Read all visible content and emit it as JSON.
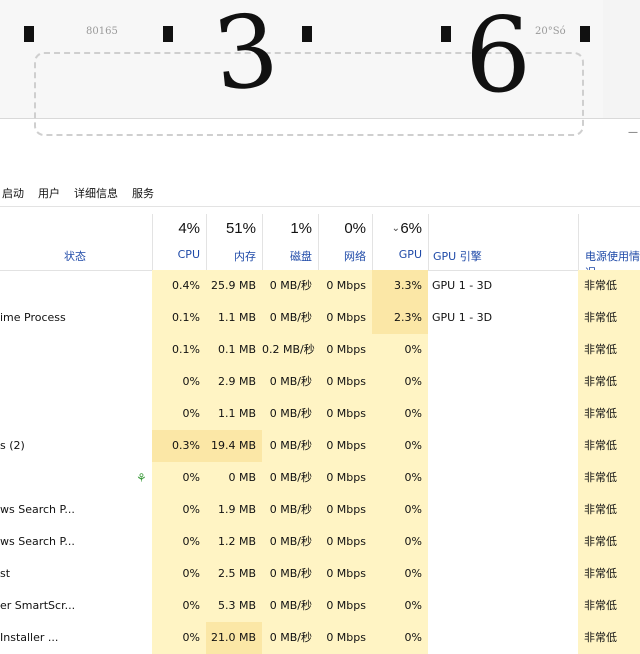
{
  "paper": {
    "printed_number": "80165",
    "printed_number2": "20°Só",
    "hand_left": "3",
    "hand_right": "6"
  },
  "tabs": [
    "启动",
    "用户",
    "详细信息",
    "服务"
  ],
  "header": {
    "status_label": "状态",
    "cpu": {
      "pct": "4%",
      "label": "CPU"
    },
    "mem": {
      "pct": "51%",
      "label": "内存"
    },
    "disk": {
      "pct": "1%",
      "label": "磁盘"
    },
    "net": {
      "pct": "0%",
      "label": "网络"
    },
    "gpu": {
      "pct": "6%",
      "label": "GPU",
      "sort_icon": "chevron-down-icon"
    },
    "gpu_engine": {
      "label": "GPU 引擎"
    },
    "power": {
      "label": "电源使用情况"
    }
  },
  "processes": [
    {
      "name": "",
      "cpu": "0.4%",
      "mem": "25.9 MB",
      "disk": "0 MB/秒",
      "net": "0 Mbps",
      "gpu": "3.3%",
      "engine": "GPU 1 - 3D",
      "power": "非常低"
    },
    {
      "name": "ime Process",
      "cpu": "0.1%",
      "mem": "1.1 MB",
      "disk": "0 MB/秒",
      "net": "0 Mbps",
      "gpu": "2.3%",
      "engine": "GPU 1 - 3D",
      "power": "非常低"
    },
    {
      "name": "",
      "cpu": "0.1%",
      "mem": "0.1 MB",
      "disk": "0.2 MB/秒",
      "net": "0 Mbps",
      "gpu": "0%",
      "engine": "",
      "power": "非常低"
    },
    {
      "name": "",
      "cpu": "0%",
      "mem": "2.9 MB",
      "disk": "0 MB/秒",
      "net": "0 Mbps",
      "gpu": "0%",
      "engine": "",
      "power": "非常低"
    },
    {
      "name": "",
      "cpu": "0%",
      "mem": "1.1 MB",
      "disk": "0 MB/秒",
      "net": "0 Mbps",
      "gpu": "0%",
      "engine": "",
      "power": "非常低"
    },
    {
      "name": "s (2)",
      "cpu": "0.3%",
      "mem": "19.4 MB",
      "disk": "0 MB/秒",
      "net": "0 Mbps",
      "gpu": "0%",
      "engine": "",
      "power": "非常低"
    },
    {
      "name": "",
      "cpu": "0%",
      "mem": "0 MB",
      "disk": "0 MB/秒",
      "net": "0 Mbps",
      "gpu": "0%",
      "engine": "",
      "power": "非常低"
    },
    {
      "name": "ws Search P...",
      "cpu": "0%",
      "mem": "1.9 MB",
      "disk": "0 MB/秒",
      "net": "0 Mbps",
      "gpu": "0%",
      "engine": "",
      "power": "非常低"
    },
    {
      "name": "ws Search P...",
      "cpu": "0%",
      "mem": "1.2 MB",
      "disk": "0 MB/秒",
      "net": "0 Mbps",
      "gpu": "0%",
      "engine": "",
      "power": "非常低"
    },
    {
      "name": "st",
      "cpu": "0%",
      "mem": "2.5 MB",
      "disk": "0 MB/秒",
      "net": "0 Mbps",
      "gpu": "0%",
      "engine": "",
      "power": "非常低"
    },
    {
      "name": "er SmartScr...",
      "cpu": "0%",
      "mem": "5.3 MB",
      "disk": "0 MB/秒",
      "net": "0 Mbps",
      "gpu": "0%",
      "engine": "",
      "power": "非常低"
    },
    {
      "name": "Installer ...",
      "cpu": "0%",
      "mem": "21.0 MB",
      "disk": "0 MB/秒",
      "net": "0 Mbps",
      "gpu": "0%",
      "engine": "",
      "power": "非常低"
    }
  ],
  "icons": {
    "efficiency_leaf": "leaf-icon",
    "close": "close-icon"
  },
  "colors": {
    "heat_light": "#fff4c4",
    "heat_mid": "#fbe7a6",
    "header_label": "#1f4aa8"
  }
}
